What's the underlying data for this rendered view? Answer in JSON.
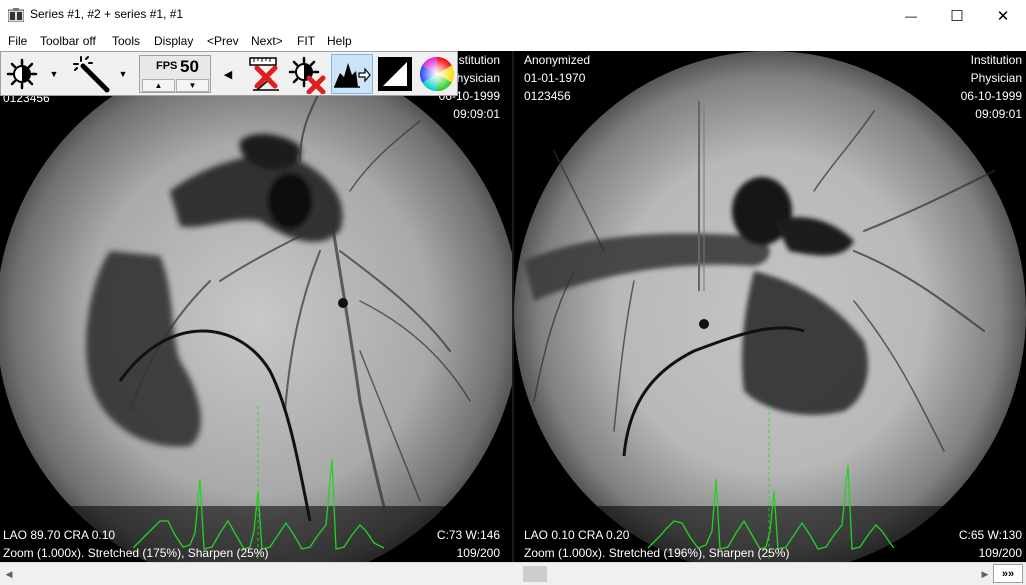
{
  "window": {
    "title": "Series #1, #2  +  series #1, #1",
    "minimize_glyph": "—",
    "maximize_glyph": "☐",
    "close_glyph": "✕"
  },
  "menu": [
    {
      "label": "File"
    },
    {
      "label": "Toolbar off"
    },
    {
      "label": "Tools"
    },
    {
      "label": "Display"
    },
    {
      "label": "<Prev"
    },
    {
      "label": "Next>"
    },
    {
      "label": "FIT"
    },
    {
      "label": "Help"
    }
  ],
  "toolbar": {
    "fps_label": "FPS",
    "fps_value": "50",
    "fps_up": "▲",
    "fps_down": "▼",
    "dropdown_arrow": "▼",
    "collapse_arrow": "◀",
    "icons": [
      "brightness-contrast-icon",
      "magic-wand-icon",
      "clear-measurements-icon",
      "reset-brightness-icon",
      "image-filter-icon",
      "invert-icon",
      "color-palette-icon"
    ]
  },
  "viewer_left": {
    "top_left": [
      "",
      "",
      "0123456"
    ],
    "top_right": [
      "Institution",
      "Physician",
      "06-10-1999",
      "09:09:01"
    ],
    "bottom_left": [
      "LAO 89.70  CRA 0.10",
      "Zoom (1.000x). Stretched (175%), Sharpen (25%)"
    ],
    "bottom_right": [
      "C:73 W:146",
      "109/200"
    ]
  },
  "viewer_right": {
    "top_left": [
      "Anonymized",
      "01-01-1970",
      "0123456"
    ],
    "top_right": [
      "Institution",
      "Physician",
      "06-10-1999",
      "09:09:01"
    ],
    "bottom_left": [
      "LAO 0.10   CRA 0.20",
      "Zoom (1.000x). Stretched (196%), Sharpen (25%)"
    ],
    "bottom_right": [
      "C:65 W:130",
      "109/200"
    ]
  },
  "scrollbar": {
    "left_arrow": "◀",
    "right_arrow": "▶",
    "fast_forward": "»»"
  },
  "colors": {
    "ecg_trace": "#22d422",
    "overlay_text": "#ffffff",
    "active_tool": "#cce4f7"
  }
}
